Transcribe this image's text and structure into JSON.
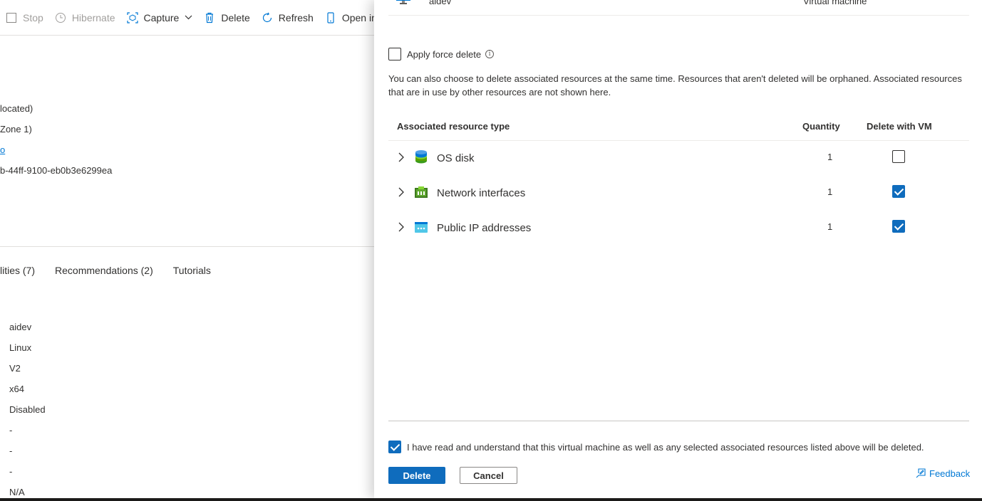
{
  "toolbar": {
    "stop": "Stop",
    "hibernate": "Hibernate",
    "capture": "Capture",
    "delete": "Delete",
    "refresh": "Refresh",
    "open_in_mobile": "Open in mo"
  },
  "essentials": {
    "status_partial": "located)",
    "location_partial": "Zone 1)",
    "link_partial": "o",
    "id_partial": "b-44ff-9100-eb0b3e6299ea"
  },
  "tabs": [
    {
      "label": "lities (7)"
    },
    {
      "label": "Recommendations (2)"
    },
    {
      "label": "Tutorials"
    }
  ],
  "properties": [
    "aidev",
    "Linux",
    "V2",
    "x64",
    "Disabled",
    "-",
    "-",
    "-",
    "N/A"
  ],
  "panel": {
    "top_resource": {
      "name": "aidev",
      "type": "Virtual machine"
    },
    "force_delete": {
      "label": "Apply force delete",
      "checked": false
    },
    "description": "You can also choose to delete associated resources at the same time. Resources that aren't deleted will be orphaned. Associated resources that are in use by other resources are not shown here.",
    "table": {
      "headers": {
        "type": "Associated resource type",
        "quantity": "Quantity",
        "delete_with_vm": "Delete with VM"
      },
      "rows": [
        {
          "name": "OS disk",
          "quantity": "1",
          "delete": false,
          "icon": "disk-icon"
        },
        {
          "name": "Network interfaces",
          "quantity": "1",
          "delete": true,
          "icon": "network-interface-icon"
        },
        {
          "name": "Public IP addresses",
          "quantity": "1",
          "delete": true,
          "icon": "public-ip-icon"
        }
      ]
    },
    "acknowledge": {
      "label": "I have read and understand that this virtual machine as well as any selected associated resources listed above will be deleted.",
      "checked": true
    },
    "buttons": {
      "delete": "Delete",
      "cancel": "Cancel"
    },
    "feedback": "Feedback"
  },
  "colors": {
    "accent": "#0f6cbd",
    "link": "#0078d4",
    "text": "#323130",
    "disabled": "#a19f9d"
  }
}
